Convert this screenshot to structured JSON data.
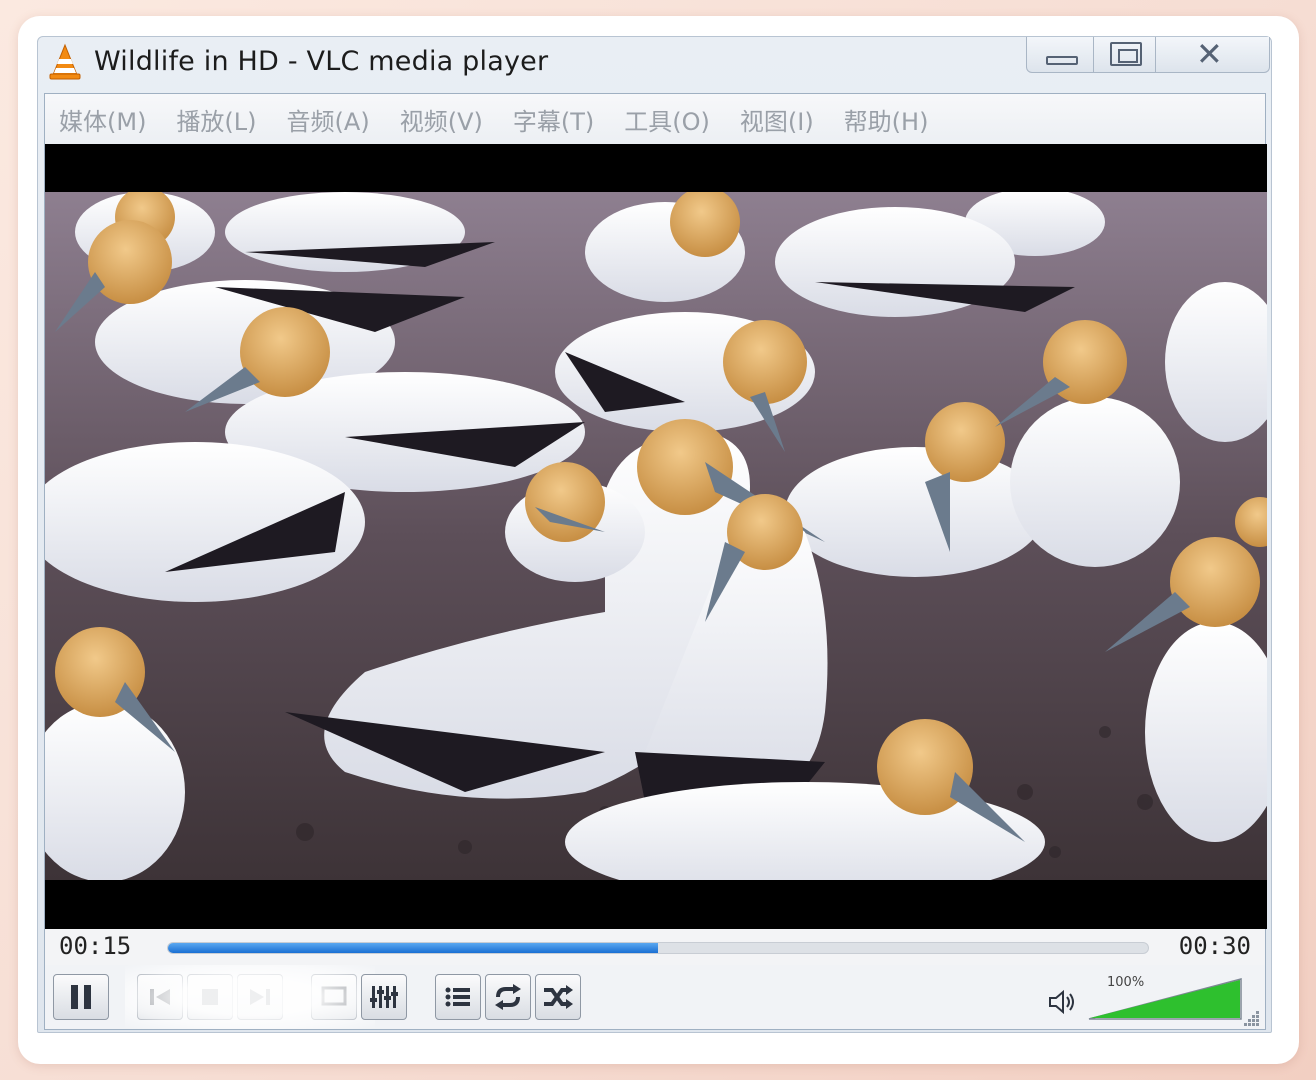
{
  "window": {
    "title": "Wildlife in HD - VLC media player",
    "caption": {
      "minimize": "minimize-icon",
      "maximize": "maximize-icon",
      "close": "✕"
    }
  },
  "menu": {
    "items": [
      "媒体(M)",
      "播放(L)",
      "音频(A)",
      "视频(V)",
      "字幕(T)",
      "工具(O)",
      "视图(I)",
      "帮助(H)"
    ]
  },
  "playback": {
    "elapsed": "00:15",
    "total": "00:30",
    "progress_fraction": 0.5
  },
  "volume": {
    "label": "100%",
    "fraction": 1.0
  },
  "colors": {
    "seek_fill": "#1a6fd3",
    "volume_fill": "#2ec02e",
    "vlc_orange": "#f28a12"
  }
}
